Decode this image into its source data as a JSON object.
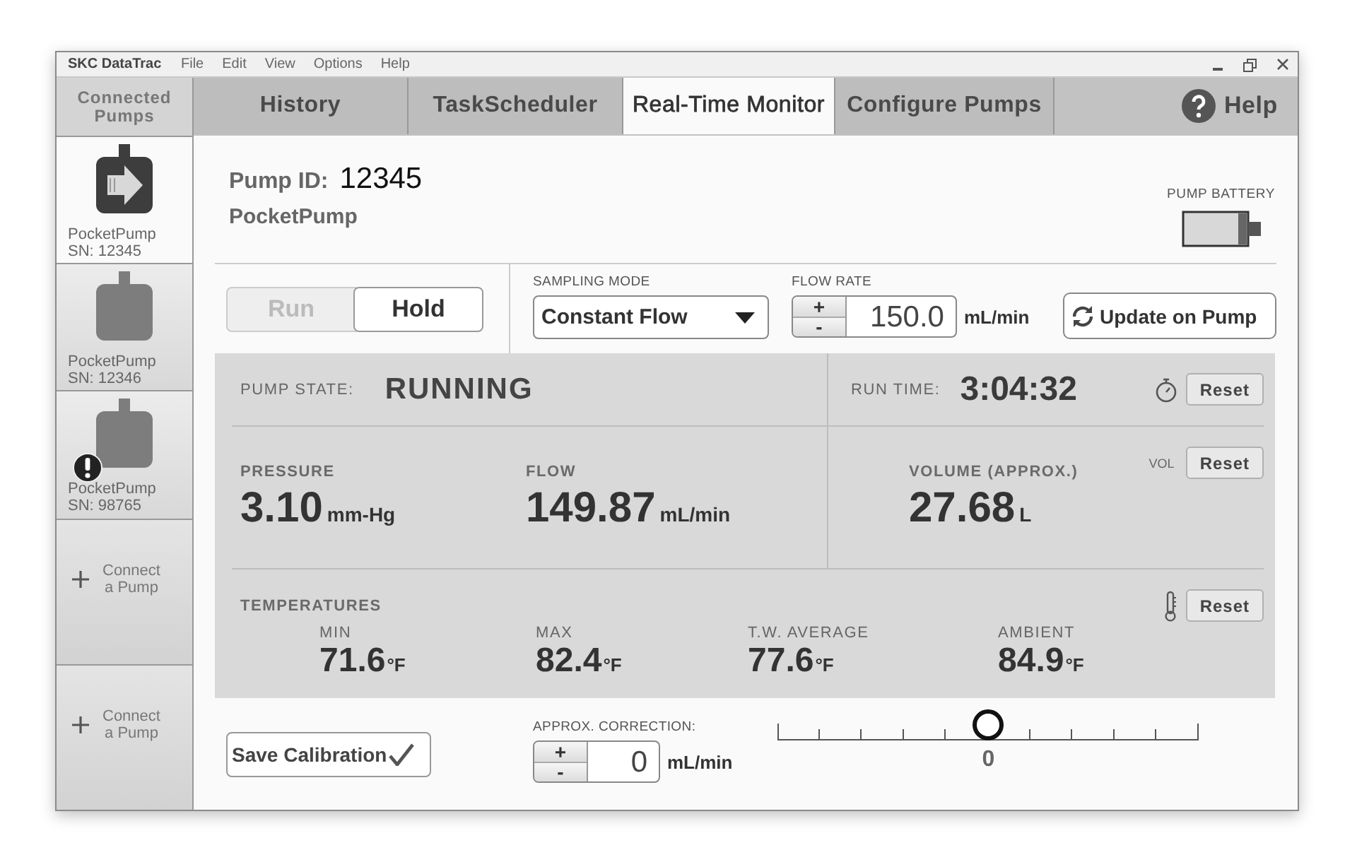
{
  "window": {
    "title": "SKC DataTrac"
  },
  "menu": [
    {
      "label": "File"
    },
    {
      "label": "Edit"
    },
    {
      "label": "View"
    },
    {
      "label": "Options"
    },
    {
      "label": "Help"
    }
  ],
  "sidebar": {
    "header": "Connected Pumps",
    "pumps": [
      {
        "name": "PocketPump",
        "serial": "SN: 12345",
        "selected": true,
        "warning": false
      },
      {
        "name": "PocketPump",
        "serial": "SN: 12346",
        "selected": false,
        "warning": false
      },
      {
        "name": "PocketPump",
        "serial": "SN: 98765",
        "selected": false,
        "warning": true
      }
    ],
    "connect_slots": [
      {
        "label": "Connect a Pump"
      },
      {
        "label": "Connect a Pump"
      }
    ]
  },
  "tabs": [
    {
      "label": "History",
      "selected": false
    },
    {
      "label": "TaskScheduler",
      "selected": false
    },
    {
      "label": "Real-Time Monitor",
      "selected": true
    },
    {
      "label": "Configure Pumps",
      "selected": false
    }
  ],
  "help": {
    "label": "Help"
  },
  "pump": {
    "id_label": "Pump ID:",
    "id": "12345",
    "model": "PocketPump",
    "battery_label": "PUMP BATTERY"
  },
  "run_controls": [
    {
      "label": "Run",
      "disabled": true
    },
    {
      "label": "Hold",
      "disabled": false
    }
  ],
  "sampling_mode": {
    "label": "SAMPLING MODE",
    "value": "Constant Flow"
  },
  "flow_rate": {
    "label": "FLOW RATE",
    "plus": "+",
    "minus": "-",
    "value": "150.0",
    "unit": "mL/min"
  },
  "update_button": {
    "label": "Update on Pump"
  },
  "pump_state": {
    "label": "PUMP STATE:",
    "value": "RUNNING"
  },
  "run_time": {
    "label": "RUN TIME:",
    "value": "3:04:32",
    "reset": "Reset"
  },
  "readings": [
    {
      "label": "PRESSURE",
      "value": "3.10",
      "unit": "mm-Hg"
    },
    {
      "label": "FLOW",
      "value": "149.87",
      "unit": "mL/min"
    }
  ],
  "volume": {
    "label": "VOLUME (APPROX.)",
    "value": "27.68",
    "unit": "L",
    "tag": "VOL",
    "reset": "Reset"
  },
  "temperatures": {
    "label": "TEMPERATURES",
    "reset": "Reset",
    "items": [
      {
        "label": "MIN",
        "value": "71.6",
        "unit": "°F"
      },
      {
        "label": "MAX",
        "value": "82.4",
        "unit": "°F"
      },
      {
        "label": "T.W. AVERAGE",
        "value": "77.6",
        "unit": "°F"
      },
      {
        "label": "AMBIENT",
        "value": "84.9",
        "unit": "°F"
      }
    ]
  },
  "calibration": {
    "save": "Save Calibration",
    "label": "APPROX. CORRECTION:",
    "plus": "+",
    "minus": "-",
    "value": "0",
    "unit": "mL/min",
    "slider": {
      "level": 0.5,
      "reading": "0"
    }
  }
}
